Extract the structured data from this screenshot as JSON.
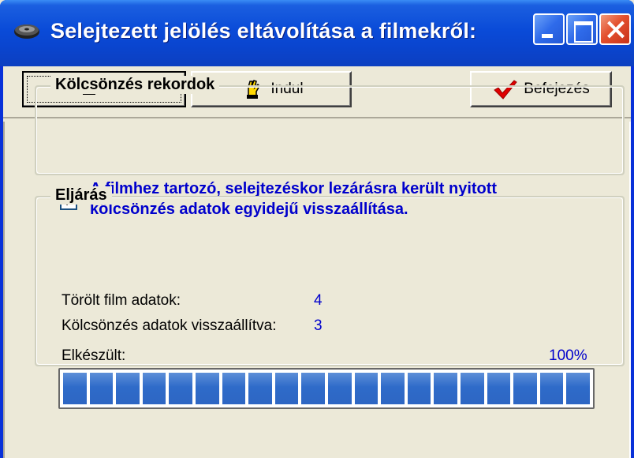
{
  "window": {
    "title": "Selejtezett jelölés eltávolítása a filmekről:",
    "title_icon": "film-reel-icon",
    "controls": [
      "minimize",
      "maximize",
      "close"
    ]
  },
  "toolbar": {
    "start_button_1": {
      "label": "Indul",
      "icon": "pointing-hand-icon",
      "focused": true
    },
    "start_button_2": {
      "label": "Indul",
      "icon": "raised-hand-icon"
    },
    "finish_button": {
      "label": "Befejezés",
      "icon": "checkmark-icon"
    }
  },
  "rental_group": {
    "title": "Kölcsönzés rekordok",
    "checkbox": {
      "checked": true,
      "label_line1": "A filmhez tartozó, selejtezéskor lezárásra került nyitott",
      "label_line2": "kölcsönzés adatok egyidejű visszaállítása."
    }
  },
  "procedure_group": {
    "title": "Eljárás",
    "deleted_label": "Törölt film adatok:",
    "deleted_value": "4",
    "restored_label": "Kölcsönzés adatok visszaállítva:",
    "restored_value": "3",
    "progress_label": "Elkészült:",
    "progress_text": "100%",
    "progress_value": 1.0,
    "progress_segments": 20
  },
  "colors": {
    "titlebar": "#0A4BD8",
    "face": "#ECE9D8",
    "accent_text": "#0000CC",
    "progress_fill": "#2F6BC9",
    "close_button": "#E3502E"
  }
}
